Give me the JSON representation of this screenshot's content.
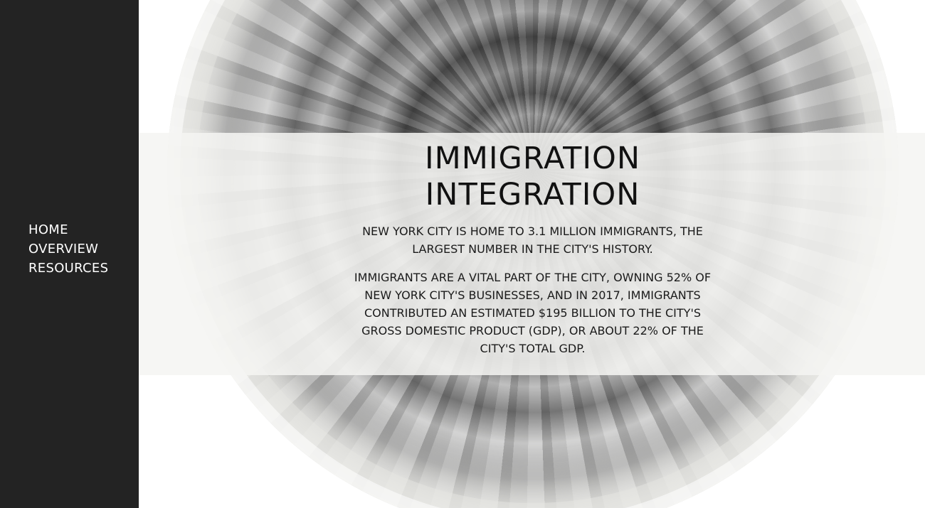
{
  "nav": {
    "items": [
      {
        "label": "HOME"
      },
      {
        "label": "OVERVIEW"
      },
      {
        "label": "RESOURCES"
      }
    ]
  },
  "hero": {
    "title_line1": "IMMIGRATION",
    "title_line2": "INTEGRATION",
    "paragraph1_line1": "NEW YORK CITY IS HOME TO 3.1 MILLION IMMIGRANTS, THE",
    "paragraph1_line2": "LARGEST NUMBER IN THE CITY'S HISTORY.",
    "paragraph2_line1": "IMMIGRANTS ARE A VITAL PART OF THE CITY, OWNING 52% OF",
    "paragraph2_line2": "NEW YORK CITY'S BUSINESSES, AND IN 2017, IMMIGRANTS",
    "paragraph2_line3": "CONTRIBUTED AN ESTIMATED $195 BILLION TO THE CITY'S",
    "paragraph2_line4": "GROSS DOMESTIC PRODUCT (GDP), OR ABOUT 22% OF THE",
    "paragraph2_line5": "CITY'S TOTAL GDP."
  },
  "colors": {
    "sidebar_bg": "#232323",
    "nav_text": "#ffffff",
    "band_bg": "#f5f4f2",
    "title_text": "#111111"
  }
}
